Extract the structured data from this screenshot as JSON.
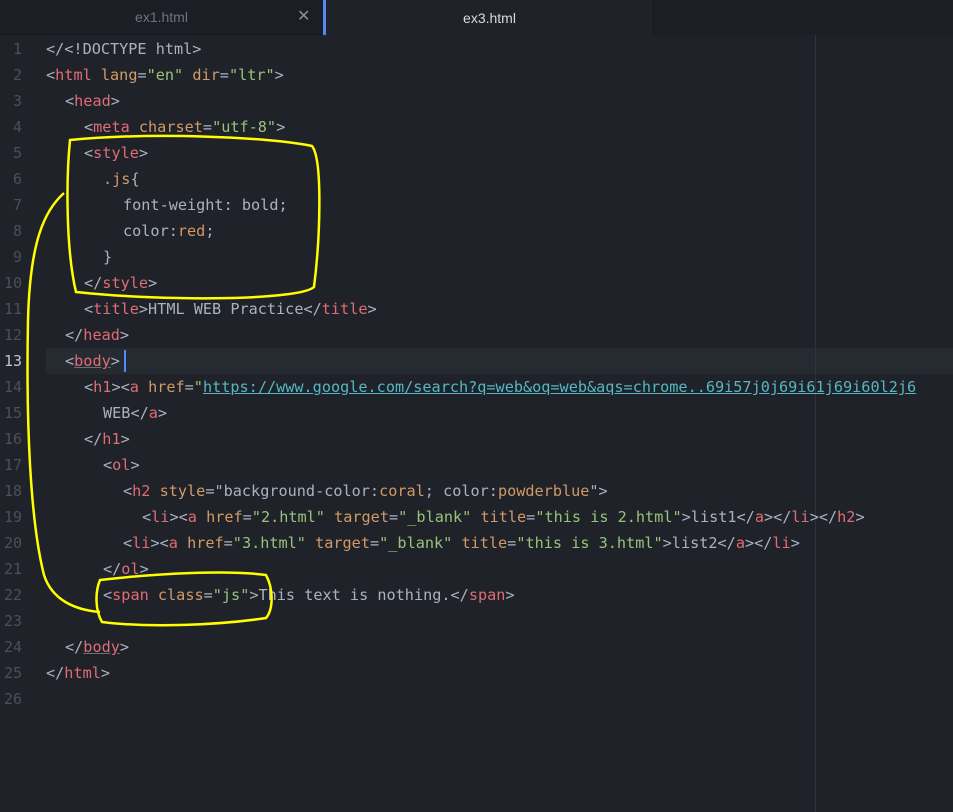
{
  "tabs": [
    {
      "label": "ex1.html",
      "active": false
    },
    {
      "label": "ex3.html",
      "active": true
    }
  ],
  "colors": {
    "background": "#1f2229",
    "tag": "#e06c75",
    "attribute": "#d19a66",
    "string": "#98c379",
    "url": "#56b6c2",
    "annotation": "#ffff00"
  },
  "line_numbers": [
    "1",
    "2",
    "3",
    "4",
    "5",
    "6",
    "7",
    "8",
    "9",
    "10",
    "11",
    "12",
    "13",
    "14",
    "15",
    "16",
    "17",
    "18",
    "19",
    "20",
    "21",
    "22",
    "23",
    "24",
    "25",
    "26"
  ],
  "active_line": "13",
  "code": {
    "l1": "</<!DOCTYPE html>",
    "l2": [
      "<",
      "html",
      " ",
      "lang",
      "=",
      "\"en\"",
      " ",
      "dir",
      "=",
      "\"ltr\"",
      ">"
    ],
    "l3": [
      "<",
      "head",
      ">"
    ],
    "l4": [
      "<",
      "meta",
      " ",
      "charset",
      "=",
      "\"utf-8\"",
      ">"
    ],
    "l5": [
      "<",
      "style",
      ">"
    ],
    "l6": [
      ".js",
      "{"
    ],
    "l7": [
      "font-weight",
      ": ",
      "bold",
      ";"
    ],
    "l8": [
      "color",
      ":",
      "red",
      ";"
    ],
    "l9": "}",
    "l10": [
      "</",
      "style",
      ">"
    ],
    "l11": [
      "<",
      "title",
      ">",
      "HTML WEB Practice",
      "</",
      "title",
      ">"
    ],
    "l12": [
      "</",
      "head",
      ">"
    ],
    "l13": [
      "<",
      "body",
      ">"
    ],
    "l14": [
      "<",
      "h1",
      "><",
      "a",
      " ",
      "href",
      "=",
      "\"",
      "https://www.google.com/search?q=web&oq=web&aqs=chrome..69i57j0j69i61j69i60l2j6"
    ],
    "l15": [
      "WEB",
      "</",
      "a",
      ">"
    ],
    "l16": [
      "</",
      "h1",
      ">"
    ],
    "l17": [
      "<",
      "ol",
      ">"
    ],
    "l18": [
      "<",
      "h2",
      " ",
      "style",
      "=",
      "\"background-color:",
      "coral",
      "; color:",
      "powderblue",
      "\"",
      ">"
    ],
    "l19": [
      "<",
      "li",
      "><",
      "a",
      " ",
      "href",
      "=",
      "\"2.html\"",
      " ",
      "target",
      "=",
      "\"_blank\"",
      " ",
      "title",
      "=",
      "\"this is 2.html\"",
      ">",
      "list1",
      "</",
      "a",
      "></",
      "li",
      "></",
      "h2",
      ">"
    ],
    "l20": [
      "<",
      "li",
      "><",
      "a",
      " ",
      "href",
      "=",
      "\"3.html\"",
      " ",
      "target",
      "=",
      "\"_blank\"",
      " ",
      "title",
      "=",
      "\"this is 3.html\"",
      ">",
      "list2",
      "</",
      "a",
      "></",
      "li",
      ">"
    ],
    "l21": [
      "</",
      "ol",
      ">"
    ],
    "l22": [
      "<",
      "span",
      " ",
      "class",
      "=",
      "\"js\"",
      ">",
      "This text is nothing.",
      "</",
      "span",
      ">"
    ],
    "l24": [
      "</",
      "body",
      ">"
    ],
    "l25": [
      "</",
      "html",
      ">"
    ]
  }
}
